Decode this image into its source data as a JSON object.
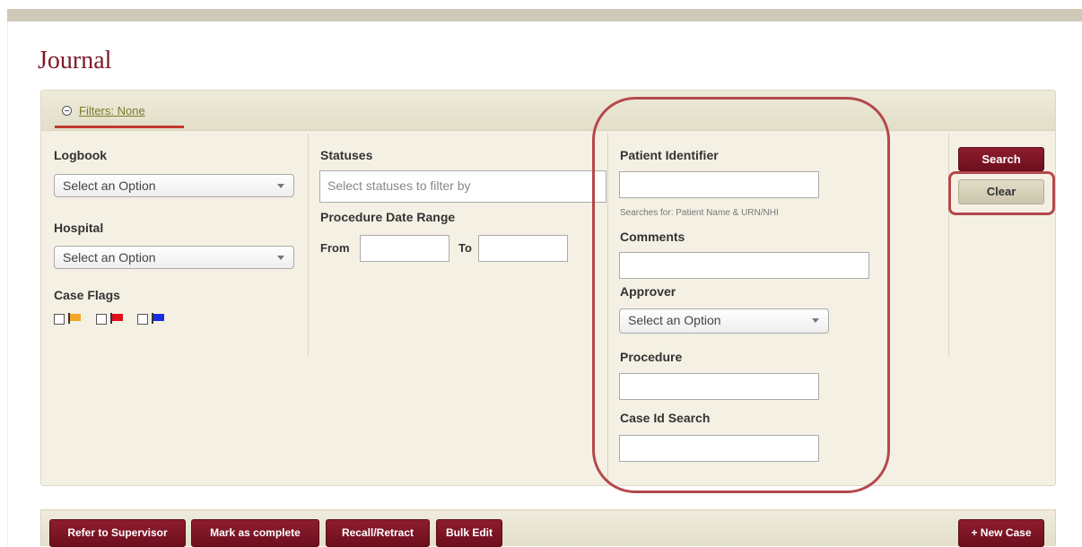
{
  "page": {
    "title": "Journal"
  },
  "filters": {
    "summary": "Filters: None",
    "logbook": {
      "label": "Logbook",
      "value": "Select an Option"
    },
    "hospital": {
      "label": "Hospital",
      "value": "Select an Option"
    },
    "case_flags": {
      "label": "Case Flags",
      "flags": [
        {
          "color": "#f5a623",
          "icon": "orange-flag-icon"
        },
        {
          "color": "#e0101a",
          "icon": "red-flag-icon"
        },
        {
          "color": "#1a2fe0",
          "icon": "blue-flag-icon"
        }
      ]
    },
    "statuses": {
      "label": "Statuses",
      "placeholder": "Select statuses to filter by"
    },
    "date_range": {
      "label": "Procedure Date Range",
      "from_label": "From",
      "to_label": "To"
    },
    "patient_identifier": {
      "label": "Patient Identifier",
      "hint": "Searches for: Patient Name & URN/NHI"
    },
    "comments": {
      "label": "Comments"
    },
    "approver": {
      "label": "Approver",
      "value": "Select an Option"
    },
    "procedure": {
      "label": "Procedure"
    },
    "case_id": {
      "label": "Case Id Search"
    },
    "search_label": "Search",
    "clear_label": "Clear"
  },
  "actions": {
    "refer": "Refer to Supervisor",
    "mark_complete": "Mark as complete",
    "recall": "Recall/Retract",
    "bulk_edit": "Bulk Edit",
    "new_case": "+ New Case"
  },
  "colors": {
    "brand": "#7b1a2a",
    "highlight": "#b5484b",
    "panel": "#f4f1e4"
  }
}
